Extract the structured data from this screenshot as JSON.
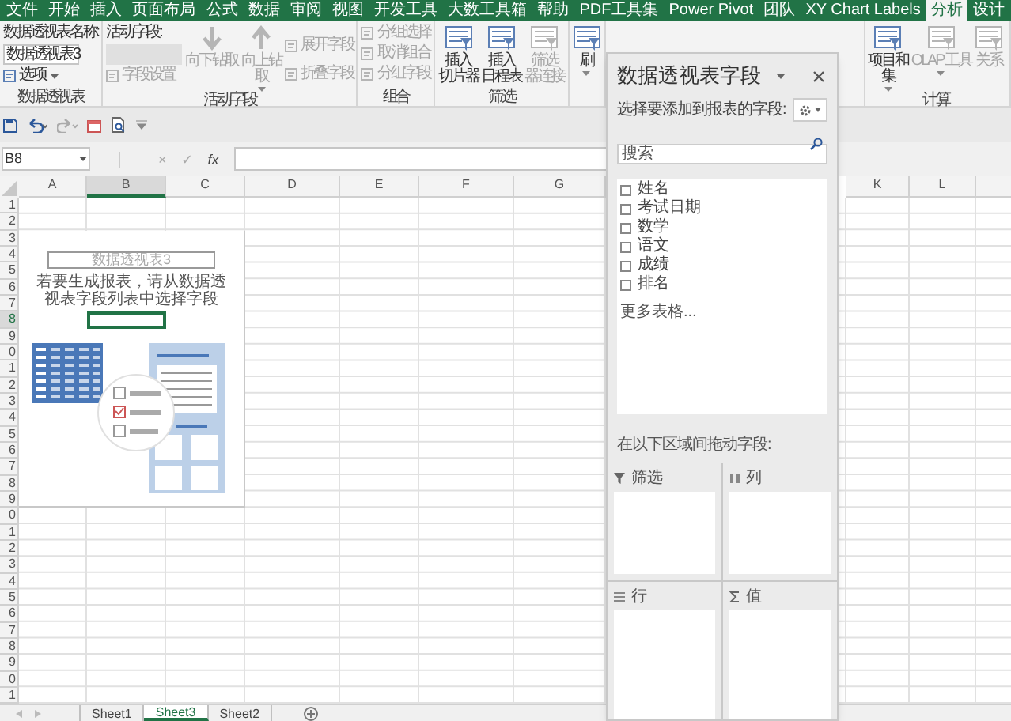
{
  "ribbon_tabs": [
    {
      "label": "文件",
      "selected": false
    },
    {
      "label": "开始",
      "selected": false
    },
    {
      "label": "插入",
      "selected": false
    },
    {
      "label": "页面布局",
      "selected": false
    },
    {
      "label": "公式",
      "selected": false
    },
    {
      "label": "数据",
      "selected": false
    },
    {
      "label": "审阅",
      "selected": false
    },
    {
      "label": "视图",
      "selected": false
    },
    {
      "label": "开发工具",
      "selected": false
    },
    {
      "label": "大数工具箱",
      "selected": false
    },
    {
      "label": "帮助",
      "selected": false
    },
    {
      "label": "PDF工具集",
      "selected": false
    },
    {
      "label": "Power Pivot",
      "selected": false
    },
    {
      "label": "团队",
      "selected": false
    },
    {
      "label": "XY Chart Labels",
      "selected": false
    },
    {
      "label": "分析",
      "selected": true
    },
    {
      "label": "设计",
      "selected": false
    }
  ],
  "ribbon_groups": [
    {
      "label": "数据透视表",
      "columns": [
        [
          {
            "kind": "text",
            "label": "数据透视表名称:"
          },
          {
            "kind": "field",
            "value": "数据透视表3",
            "disabled": false
          },
          {
            "kind": "small",
            "label": "选项",
            "dropdown": true,
            "disabled": false
          }
        ]
      ]
    },
    {
      "label": "活动字段",
      "columns": [
        [
          {
            "kind": "text",
            "label": "活动字段:"
          },
          {
            "kind": "field",
            "disabled": true
          },
          {
            "kind": "small",
            "label": "字段设置",
            "dropdown": false,
            "disabled": true
          }
        ],
        [
          {
            "kind": "large",
            "lines": [
              "向下钻取"
            ],
            "dropdown": false,
            "disabled": true
          }
        ],
        [
          {
            "kind": "large",
            "lines": [
              "向上钻",
              "取"
            ],
            "dropdown": true,
            "disabled": true
          }
        ],
        [
          {
            "kind": "small",
            "label": "展开字段",
            "dropdown": false,
            "disabled": true
          },
          {
            "kind": "small",
            "label": "折叠字段",
            "dropdown": false,
            "disabled": true
          }
        ]
      ]
    },
    {
      "label": "组合",
      "columns": [
        [
          {
            "kind": "small",
            "label": "分组选择",
            "dropdown": false,
            "disabled": true
          },
          {
            "kind": "small",
            "label": "取消组合",
            "dropdown": false,
            "disabled": true
          },
          {
            "kind": "small",
            "label": "分组字段",
            "dropdown": false,
            "disabled": true
          }
        ]
      ]
    },
    {
      "label": "筛选",
      "columns": [
        [
          {
            "kind": "large",
            "lines": [
              "插入",
              "切片器"
            ],
            "dropdown": false,
            "disabled": false
          }
        ],
        [
          {
            "kind": "large",
            "lines": [
              "插入",
              "日程表"
            ],
            "dropdown": false,
            "disabled": false
          }
        ],
        [
          {
            "kind": "large",
            "lines": [
              "筛选",
              "器连接"
            ],
            "dropdown": false,
            "disabled": true
          }
        ]
      ]
    },
    {
      "columns": [
        [
          {
            "kind": "large",
            "lines": [
              "刷"
            ],
            "dropdown": true,
            "disabled": false
          }
        ]
      ]
    },
    {
      "label": "计算",
      "columns": [
        [
          {
            "kind": "large",
            "lines": [
              "项目和",
              "集"
            ],
            "dropdown": true,
            "disabled": false
          }
        ],
        [
          {
            "kind": "large",
            "lines": [
              "OLAP 工具"
            ],
            "dropdown": true,
            "disabled": true
          }
        ],
        [
          {
            "kind": "large",
            "lines": [
              "关系"
            ],
            "dropdown": false,
            "disabled": true
          }
        ]
      ]
    }
  ],
  "formula_bar": {
    "name_box": "B8",
    "buttons": [
      "×",
      "✓",
      "fx"
    ]
  },
  "sheet": {
    "columns": [
      {
        "label": "A",
        "selected": false
      },
      {
        "label": "B",
        "selected": true
      },
      {
        "label": "C",
        "selected": false
      },
      {
        "label": "D",
        "selected": false
      },
      {
        "label": "E",
        "selected": false
      },
      {
        "label": "F",
        "selected": false
      },
      {
        "label": "G",
        "selected": false
      },
      {
        "label": "K",
        "selected": false
      },
      {
        "label": "L",
        "selected": false
      }
    ],
    "rows": [
      {
        "label": "1",
        "selected": false
      },
      {
        "label": "2",
        "selected": false
      },
      {
        "label": "3",
        "selected": false
      },
      {
        "label": "4",
        "selected": false
      },
      {
        "label": "5",
        "selected": false
      },
      {
        "label": "6",
        "selected": false
      },
      {
        "label": "7",
        "selected": false
      },
      {
        "label": "8",
        "selected": true
      },
      {
        "label": "9",
        "selected": false
      },
      {
        "label": "0",
        "selected": false
      },
      {
        "label": "1",
        "selected": false
      },
      {
        "label": "2",
        "selected": false
      },
      {
        "label": "3",
        "selected": false
      },
      {
        "label": "4",
        "selected": false
      },
      {
        "label": "5",
        "selected": false
      },
      {
        "label": "6",
        "selected": false
      },
      {
        "label": "7",
        "selected": false
      },
      {
        "label": "8",
        "selected": false
      },
      {
        "label": "9",
        "selected": false
      },
      {
        "label": "0",
        "selected": false
      },
      {
        "label": "1",
        "selected": false
      },
      {
        "label": "2",
        "selected": false
      },
      {
        "label": "3",
        "selected": false
      },
      {
        "label": "4",
        "selected": false
      },
      {
        "label": "5",
        "selected": false
      },
      {
        "label": "6",
        "selected": false
      },
      {
        "label": "7",
        "selected": false
      },
      {
        "label": "8",
        "selected": false
      },
      {
        "label": "9",
        "selected": false
      },
      {
        "label": "0",
        "selected": false
      },
      {
        "label": "1",
        "selected": false
      }
    ],
    "pivot_placeholder": {
      "title": "数据透视表3",
      "message": "若要生成报表，请从数据透视表字段列表中选择字段"
    }
  },
  "field_pane": {
    "title": "数据透视表字段",
    "prompt": "选择要添加到报表的字段:",
    "search": {
      "placeholder": "搜索"
    },
    "fields": [
      {
        "label": "姓名",
        "checked": false
      },
      {
        "label": "考试日期",
        "checked": false
      },
      {
        "label": "数学",
        "checked": false
      },
      {
        "label": "语文",
        "checked": false
      },
      {
        "label": "成绩",
        "checked": false
      },
      {
        "label": "排名",
        "checked": false
      }
    ],
    "more_tables": "更多表格...",
    "drag_prompt": "在以下区域间拖动字段:",
    "areas": [
      {
        "label": "筛选"
      },
      {
        "label": "列"
      },
      {
        "label": "行"
      },
      {
        "label": "值"
      }
    ]
  },
  "sheet_tabs": [
    {
      "label": "Sheet1",
      "selected": false
    },
    {
      "label": "Sheet3",
      "selected": true
    },
    {
      "label": "Sheet2",
      "selected": false
    }
  ]
}
